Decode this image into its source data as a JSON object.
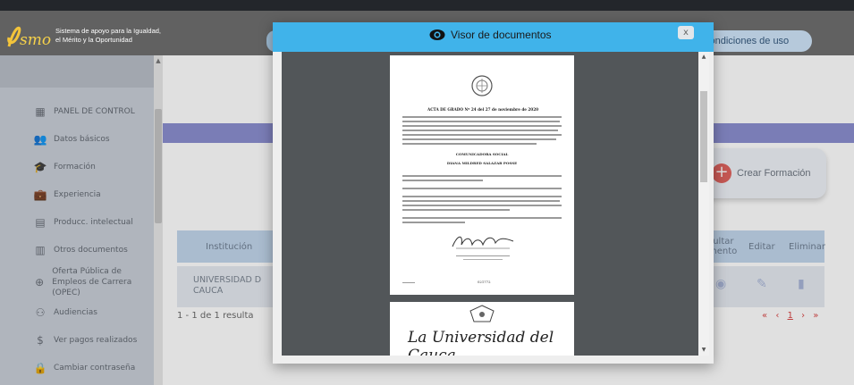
{
  "header": {
    "logo_text": "smo",
    "title_line1": "Sistema de apoyo para la Igualdad,",
    "title_line2": "el Mérito y la Oportunidad",
    "terms_label": "condiciones de uso"
  },
  "sidebar": {
    "items": [
      {
        "label": "PANEL DE CONTROL",
        "icon": "dashboard-icon"
      },
      {
        "label": "Datos básicos",
        "icon": "people-icon"
      },
      {
        "label": "Formación",
        "icon": "graduation-icon"
      },
      {
        "label": "Experiencia",
        "icon": "briefcase-icon"
      },
      {
        "label": "Producc. intelectual",
        "icon": "book-icon"
      },
      {
        "label": "Otros documentos",
        "icon": "document-icon"
      },
      {
        "label": "Oferta Pública de",
        "label2": "Empleos de Carrera (OPEC)",
        "icon": "globe-icon"
      },
      {
        "label": "Audiencias",
        "icon": "audience-icon"
      },
      {
        "label": "Ver pagos realizados",
        "icon": "dollar-icon"
      },
      {
        "label": "Cambiar contraseña",
        "icon": "lock-icon"
      }
    ]
  },
  "main": {
    "crear_label": "Crear Formación",
    "table": {
      "headers": {
        "institucion": "Institución",
        "consultar_line1": "sultar",
        "consultar_line2": "mento",
        "editar": "Editar",
        "eliminar": "Eliminar"
      },
      "row": {
        "institucion_line1": "UNIVERSIDAD D",
        "institucion_line2": "CAUCA"
      }
    },
    "result_count": "1 - 1 de 1 resulta",
    "pager": {
      "first": "«",
      "prev": "‹",
      "current": "1",
      "next": "›",
      "last": "»"
    }
  },
  "modal": {
    "title": "Visor de documentos",
    "close_label": "x",
    "document": {
      "title": "ACTA DE GRADO Nº 24 del 27 de noviembre de 2020",
      "degree": "COMUNICADORA SOCIAL",
      "recipient": "DIANA MILDRED SALAZAR POSSE",
      "footer_number": "021772",
      "university_heading": "La Universidad del Cauca"
    }
  },
  "colors": {
    "modal_header": "#40b3ea",
    "sidebar_bg": "#c9cfd8",
    "accent_bar": "#8b8fd0",
    "crear_icon": "#e0635f",
    "pager": "#d94848"
  }
}
